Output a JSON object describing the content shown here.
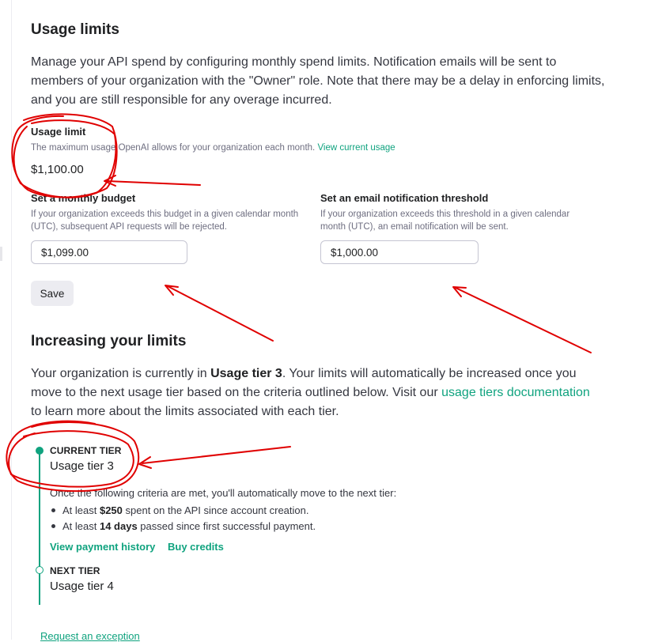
{
  "usage_limits": {
    "title": "Usage limits",
    "description": "Manage your API spend by configuring monthly spend limits. Notification emails will be sent to members of your organization with the \"Owner\" role. Note that there may be a delay in enforcing limits, and you are still responsible for any overage incurred.",
    "usage_limit": {
      "label": "Usage limit",
      "help": "The maximum usage OpenAI allows for your organization each month.",
      "link": "View current usage",
      "value": "$1,100.00"
    },
    "budget": {
      "label": "Set a monthly budget",
      "help": "If your organization exceeds this budget in a given calendar month (UTC), subsequent API requests will be rejected.",
      "value": "$1,099.00"
    },
    "threshold": {
      "label": "Set an email notification threshold",
      "help": "If your organization exceeds this threshold in a given calendar month (UTC), an email notification will be sent.",
      "value": "$1,000.00"
    },
    "save_label": "Save"
  },
  "increasing": {
    "title": "Increasing your limits",
    "intro_before": "Your organization is currently in ",
    "intro_tier": "Usage tier 3",
    "intro_after": ". Your limits will automatically be increased once you move to the next usage tier based on the criteria outlined below. Visit our ",
    "intro_link": "usage tiers documentation",
    "intro_end": " to learn more about the limits associated with each tier.",
    "current_tier": {
      "kicker": "CURRENT TIER",
      "name": "Usage tier 3"
    },
    "criteria_intro": "Once the following criteria are met, you'll automatically move to the next tier:",
    "criteria": [
      {
        "prefix": "At least ",
        "strong": "$250",
        "suffix": " spent on the API since account creation."
      },
      {
        "prefix": "At least ",
        "strong": "14 days",
        "suffix": " passed since first successful payment."
      }
    ],
    "links": {
      "payment_history": "View payment history",
      "buy_credits": "Buy credits"
    },
    "next_tier": {
      "kicker": "NEXT TIER",
      "name": "Usage tier 4"
    },
    "exception_link": "Request an exception"
  },
  "colors": {
    "accent": "#10a37f",
    "annotation": "#e00000"
  }
}
